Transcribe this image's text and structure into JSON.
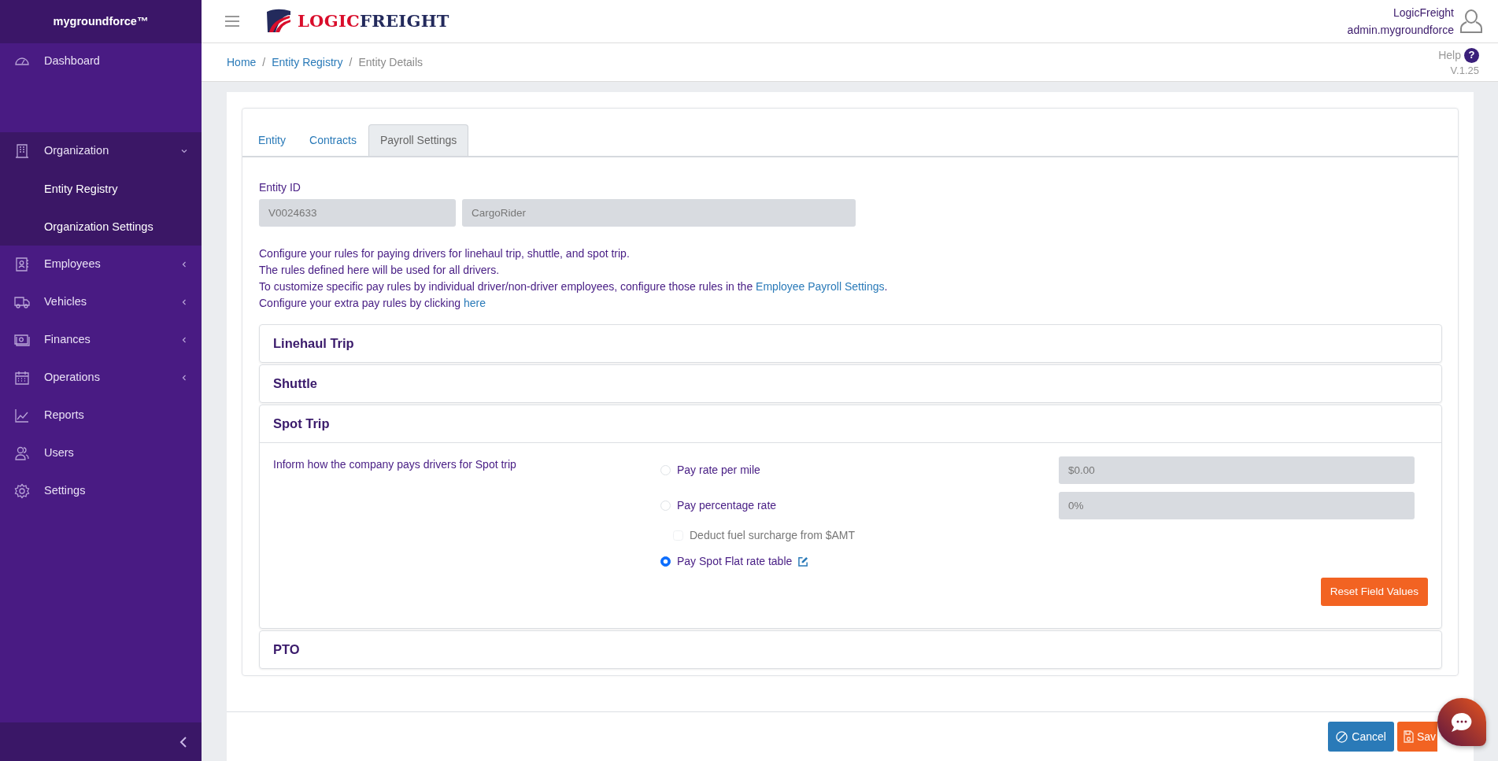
{
  "sidebar": {
    "brand": "mygroundforce™",
    "items": [
      {
        "kind": "link",
        "label": "Dashboard"
      },
      {
        "kind": "group",
        "label": "Organization",
        "expanded": true,
        "children": [
          {
            "label": "Entity Registry"
          },
          {
            "label": "Organization Settings"
          }
        ]
      },
      {
        "kind": "group",
        "label": "Employees",
        "expanded": false
      },
      {
        "kind": "group",
        "label": "Vehicles",
        "expanded": false
      },
      {
        "kind": "group",
        "label": "Finances",
        "expanded": false
      },
      {
        "kind": "group",
        "label": "Operations",
        "expanded": false
      },
      {
        "kind": "link",
        "label": "Reports"
      },
      {
        "kind": "link",
        "label": "Users"
      },
      {
        "kind": "link",
        "label": "Settings"
      }
    ]
  },
  "header": {
    "logo": {
      "part_1": "LOGIC",
      "part_2": "FREIGHT"
    },
    "user": {
      "company": "LogicFreight",
      "account": "admin.mygroundforce"
    }
  },
  "breadcrumb": {
    "separator": "/",
    "items": [
      {
        "label": "Home",
        "current": false
      },
      {
        "label": "Entity Registry",
        "current": false
      },
      {
        "label": "Entity Details",
        "current": true
      }
    ]
  },
  "help": {
    "label": "Help",
    "icon": "?",
    "version": "V.1.25"
  },
  "tabs": [
    {
      "label": "Entity",
      "selected": false
    },
    {
      "label": "Contracts",
      "selected": false
    },
    {
      "label": "Payroll Settings",
      "selected": true
    }
  ],
  "entity": {
    "label": "Entity ID",
    "fields": [
      {
        "value": "V0024633",
        "disabled": true
      },
      {
        "value": "CargoRider",
        "disabled": true
      }
    ]
  },
  "description": [
    {
      "text": "Configure your rules for paying drivers for linehaul trip, shuttle, and spot trip."
    },
    {
      "text": "The rules defined here will be used for all drivers."
    },
    {
      "text": "To customize specific pay rules by individual driver/non-driver employees, configure those rules in the ",
      "link": "Employee Payroll Settings",
      "after": "."
    },
    {
      "text": "Configure your extra pay rules by clicking ",
      "link": "here"
    }
  ],
  "sections": [
    {
      "title": "Linehaul Trip"
    },
    {
      "title": "Shuttle"
    },
    {
      "title": "Spot Trip",
      "body": {
        "prompt": "Inform how the company pays drivers for Spot trip",
        "options": [
          {
            "kind": "radio",
            "label": "Pay rate per mile",
            "selected": false,
            "value": "$0.00"
          },
          {
            "kind": "radio",
            "label": "Pay percentage rate",
            "selected": false,
            "value": "0%"
          },
          {
            "kind": "checkbox",
            "label": "Deduct fuel surcharge from $AMT",
            "checked": false,
            "disabled": true
          },
          {
            "kind": "radio",
            "label": "Pay Spot Flat rate table",
            "selected": true,
            "editable": true
          }
        ],
        "reset_button": "Reset Field Values"
      }
    },
    {
      "title": "PTO"
    }
  ],
  "footer": {
    "cancel_button": "Cancel",
    "save_button": "Sav"
  }
}
